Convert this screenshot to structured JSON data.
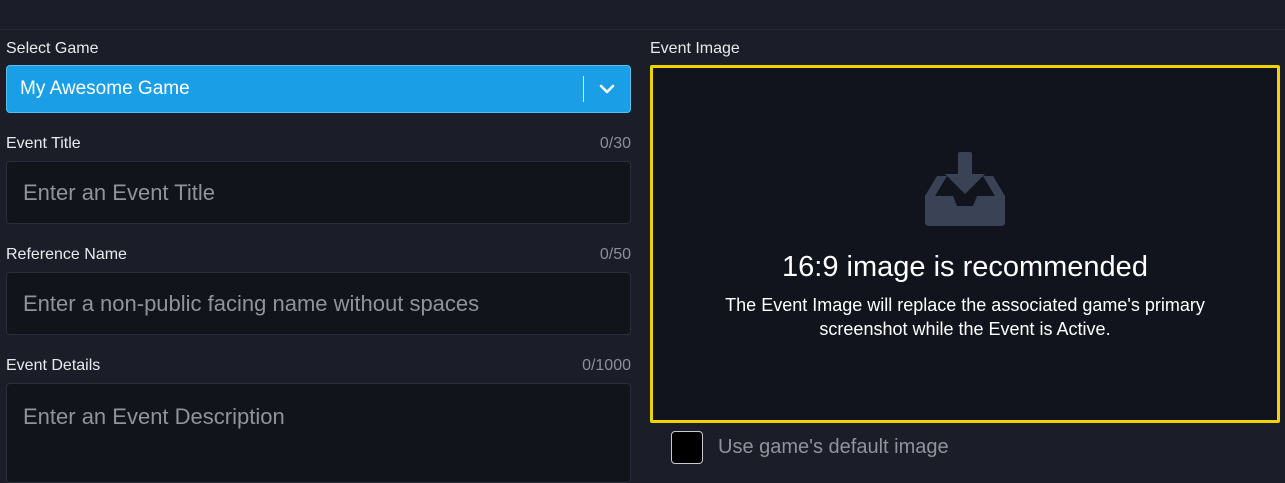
{
  "form": {
    "select_game": {
      "label": "Select Game",
      "value": "My Awesome Game",
      "icon": "chevron-down-icon"
    },
    "event_title": {
      "label": "Event Title",
      "counter": "0/30",
      "value": "",
      "placeholder": "Enter an Event Title"
    },
    "reference_name": {
      "label": "Reference Name",
      "counter": "0/50",
      "value": "",
      "placeholder": "Enter a non-public facing name without spaces"
    },
    "event_details": {
      "label": "Event Details",
      "counter": "0/1000",
      "value": "",
      "placeholder": "Enter an Event Description"
    }
  },
  "event_image": {
    "label": "Event Image",
    "icon": "download-tray-icon",
    "heading": "16:9 image is recommended",
    "description_line1": "The Event Image will replace the associated game's primary",
    "description_line2": "screenshot while the Event is Active.",
    "default_checkbox": {
      "label": "Use game's default image",
      "checked": false
    }
  },
  "colors": {
    "background": "#1b1e28",
    "input_background": "#11141b",
    "select_accent": "#1a9fe6",
    "drop_zone_border": "#f0d400",
    "muted_text": "#8f939b"
  }
}
